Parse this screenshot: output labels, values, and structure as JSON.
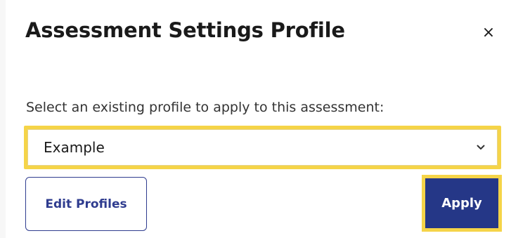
{
  "dialog": {
    "title": "Assessment Settings Profile",
    "close_icon": "close-icon",
    "close_glyph": "×"
  },
  "form": {
    "prompt": "Select an existing profile to apply to this assessment:",
    "select": {
      "selected_value": "Example",
      "chevron_icon": "chevron-down-icon"
    },
    "edit_profiles_label": "Edit Profiles",
    "apply_label": "Apply"
  },
  "colors": {
    "focus_ring": "#f5d448",
    "primary": "#253787",
    "outline_button": "#2f3c8f"
  }
}
